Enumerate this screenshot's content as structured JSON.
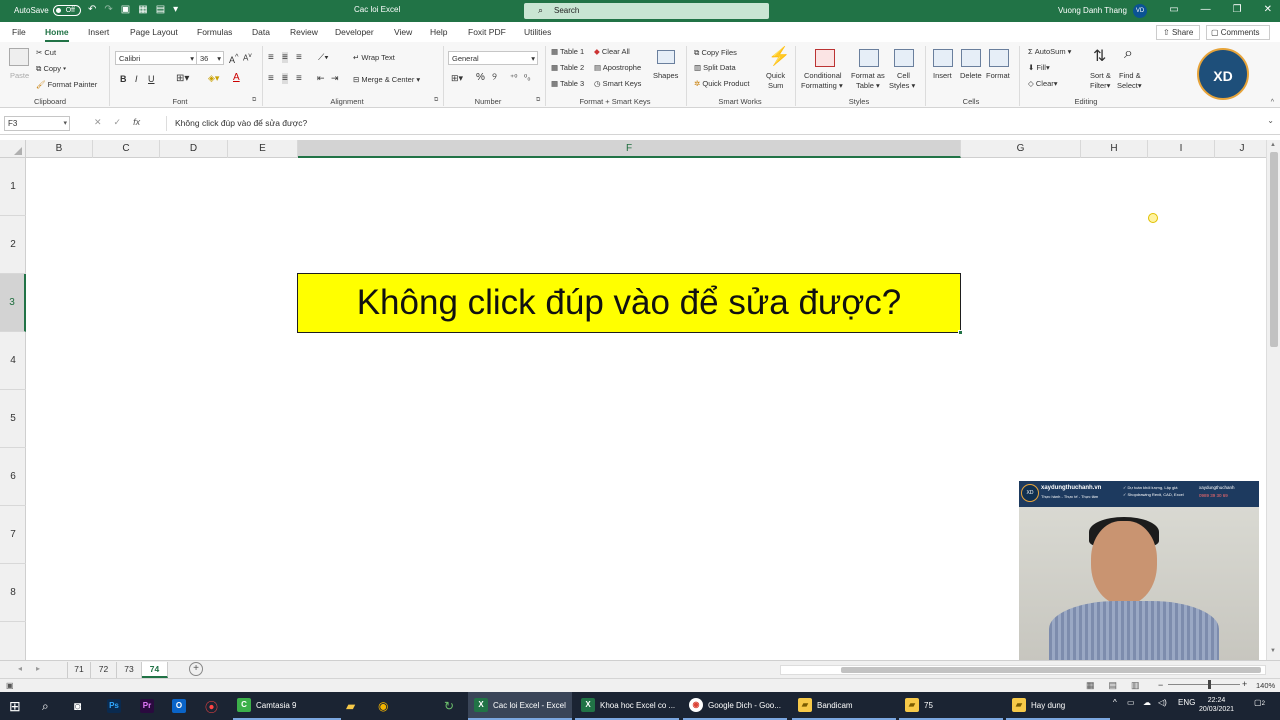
{
  "titlebar": {
    "autosave_label": "AutoSave",
    "autosave_state": "Off",
    "doc_title": "Cac loi Excel",
    "search_placeholder": "Search",
    "user_name": "Vuong Danh Thang",
    "user_initials": "VD"
  },
  "tabs": [
    "File",
    "Home",
    "Insert",
    "Page Layout",
    "Formulas",
    "Data",
    "Review",
    "Developer",
    "View",
    "Help",
    "Foxit PDF",
    "Utilities"
  ],
  "active_tab": "Home",
  "share_label": "Share",
  "comments_label": "Comments",
  "ribbon": {
    "clipboard": {
      "paste": "Paste",
      "cut": "Cut",
      "copy": "Copy",
      "format_painter": "Format Painter",
      "label": "Clipboard"
    },
    "font": {
      "name": "Calibri",
      "size": "36",
      "label": "Font",
      "bold": "B",
      "italic": "I",
      "underline": "U"
    },
    "alignment": {
      "wrap": "Wrap Text",
      "merge": "Merge & Center",
      "label": "Alignment"
    },
    "number": {
      "format": "General",
      "label": "Number"
    },
    "format_smart_keys": {
      "table1": "Table 1",
      "table2": "Table 2",
      "table3": "Table 3",
      "clear_all": "Clear All",
      "apostrophe": "Apostrophe",
      "smart_keys": "Smart Keys",
      "shapes": "Shapes",
      "label": "Format + Smart Keys"
    },
    "smart_works": {
      "copy_files": "Copy Files",
      "split_data": "Split Data",
      "quick_product": "Quick Product",
      "quick_sum_1": "Quick",
      "quick_sum_2": "Sum",
      "label": "Smart Works"
    },
    "styles": {
      "cond1": "Conditional",
      "cond2": "Formatting",
      "fat1": "Format as",
      "fat2": "Table",
      "cs1": "Cell",
      "cs2": "Styles",
      "label": "Styles"
    },
    "cells": {
      "insert": "Insert",
      "delete": "Delete",
      "format": "Format",
      "label": "Cells"
    },
    "editing": {
      "autosum": "AutoSum",
      "fill": "Fill",
      "clear": "Clear",
      "sort1": "Sort &",
      "sort2": "Filter",
      "find1": "Find &",
      "find2": "Select",
      "label": "Editing"
    },
    "brand_logo": "XD"
  },
  "formula_bar": {
    "name_box": "F3",
    "fx": "fx",
    "formula": "Không click đúp vào để sửa được?"
  },
  "grid": {
    "columns": [
      "B",
      "C",
      "D",
      "E",
      "F",
      "G",
      "H",
      "I",
      "J"
    ],
    "selected_column": "F",
    "rows": [
      "1",
      "2",
      "3",
      "4",
      "5",
      "6",
      "7",
      "8"
    ],
    "selected_row": "3",
    "cell_f3_value": "Không click đúp vào để sửa được?",
    "cell_f3_fill": "#ffff00"
  },
  "webcam": {
    "site": "xaydungthuchanh.vn",
    "tagline": "Thực hành - Thực tế - Thực tâm",
    "bullet1": "✓ Dự toán khối lượng, Lập giá",
    "bullet2": "✓ Shopdrawing Revit, CAD, Excel",
    "contact1": "xaydungthuchanh",
    "contact2": "0989 39 30 69",
    "logo": "XD"
  },
  "sheets": [
    "71",
    "72",
    "73",
    "74"
  ],
  "active_sheet": "74",
  "status": {
    "zoom": "140%"
  },
  "taskbar": {
    "apps": [
      {
        "label": "Camtasia 9",
        "icon": "camtasia-icon"
      },
      {
        "label": "Cac loi Excel - Excel",
        "icon": "excel-icon"
      },
      {
        "label": "Khoa hoc Excel co ...",
        "icon": "excel-icon"
      },
      {
        "label": "Google Dich - Goo...",
        "icon": "chrome-icon"
      },
      {
        "label": "Bandicam",
        "icon": "folder-icon"
      },
      {
        "label": "75",
        "icon": "folder-icon"
      },
      {
        "label": "Hay dung",
        "icon": "folder-icon"
      }
    ],
    "lang": "ENG",
    "time": "22:24",
    "date": "20/03/2021",
    "notif_count": "2"
  },
  "colors": {
    "excel_green": "#217346",
    "highlight": "#ffff00",
    "taskbar": "#1b2433"
  }
}
